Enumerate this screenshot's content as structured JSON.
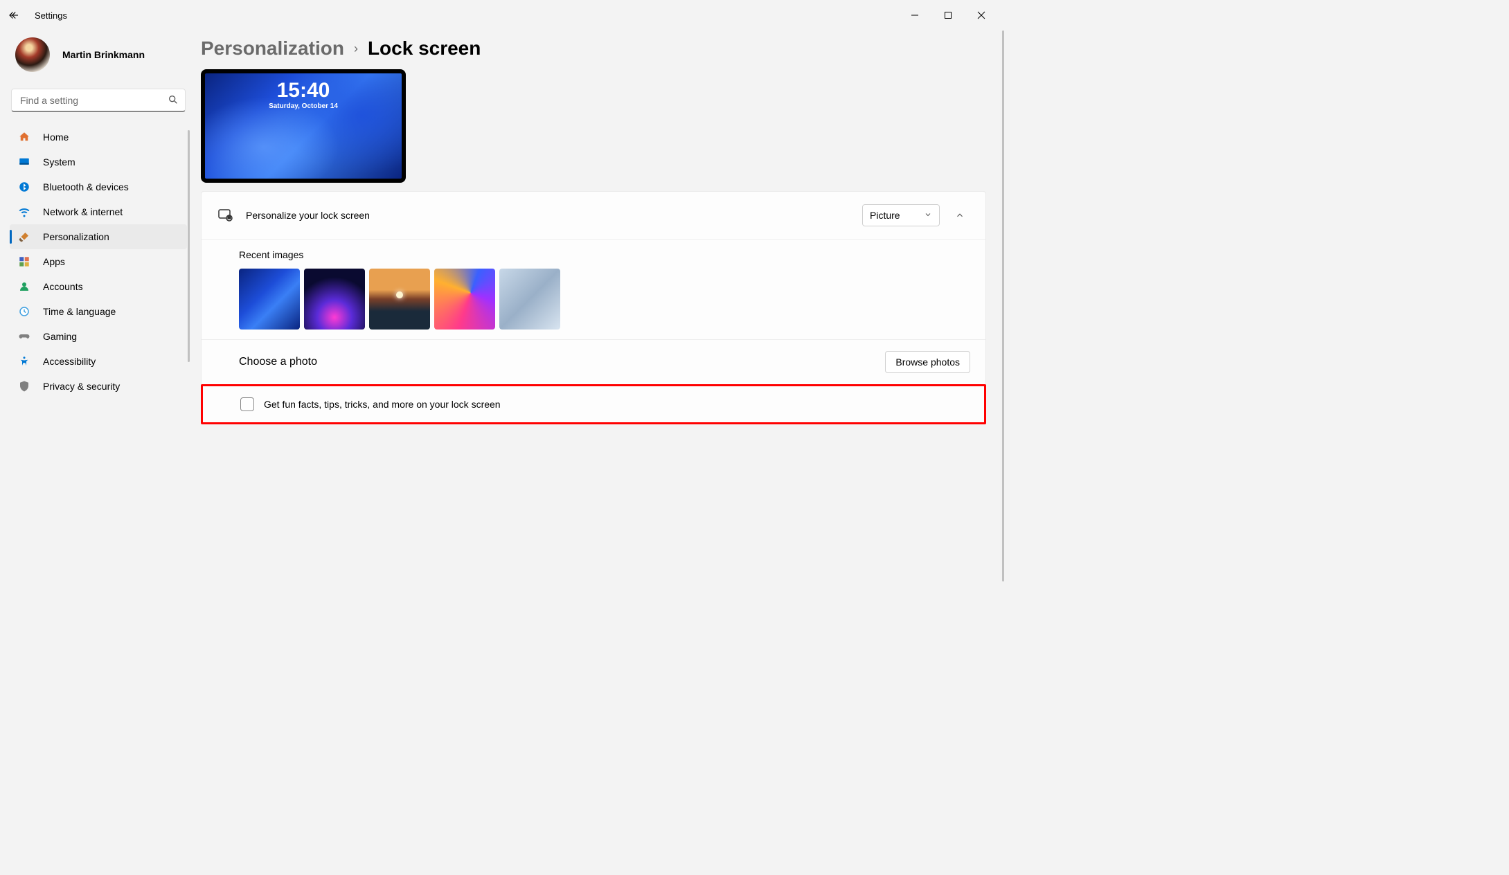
{
  "app": {
    "title": "Settings"
  },
  "window": {
    "minimize": "–",
    "maximize": "□",
    "close": "×"
  },
  "profile": {
    "name": "Martin Brinkmann"
  },
  "search": {
    "placeholder": "Find a setting"
  },
  "nav": {
    "items": [
      {
        "label": "Home"
      },
      {
        "label": "System"
      },
      {
        "label": "Bluetooth & devices"
      },
      {
        "label": "Network & internet"
      },
      {
        "label": "Personalization"
      },
      {
        "label": "Apps"
      },
      {
        "label": "Accounts"
      },
      {
        "label": "Time & language"
      },
      {
        "label": "Gaming"
      },
      {
        "label": "Accessibility"
      },
      {
        "label": "Privacy & security"
      }
    ],
    "active_index": 4
  },
  "breadcrumb": {
    "parent": "Personalization",
    "current": "Lock screen"
  },
  "preview": {
    "time": "15:40",
    "date": "Saturday, October 14"
  },
  "personalize": {
    "title": "Personalize your lock screen",
    "select_value": "Picture",
    "recent_label": "Recent images",
    "choose_label": "Choose a photo",
    "browse_label": "Browse photos",
    "funfacts_label": "Get fun facts, tips, tricks, and more on your lock screen",
    "funfacts_checked": false
  }
}
